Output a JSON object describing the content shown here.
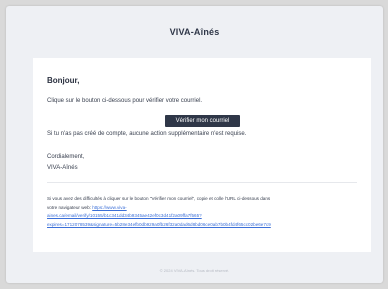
{
  "email": {
    "brand": "VIVA-Aînés",
    "greeting": "Bonjour,",
    "intro": "Clique sur le bouton ci-dessous pour vérifier votre courriel.",
    "verify_button": "Vérifier mon courriel",
    "no_account_note": "Si tu n'as pas créé de compte, aucune action supplémentaire n'est requise.",
    "closing": "Cordialement,",
    "signature": "VIVA-Aînés",
    "fallback_text": "Si vous avez des difficultés à cliquer sur le bouton \"Vérifier mon courriel\", copie et colle l'URL ci-dessous dans",
    "fallback_text_2": "votre navigateur web:",
    "fallback_link_1": "https://www.viva-",
    "fallback_link_2": "aines.ca/email/verify/10155/b1c341dd34b9345ae42ef0c3d41f2a09ffa7f565?",
    "fallback_link_3": "expires=1712078539&signature=5b28e34efb0db929a0fb26f32a0dad6d8bd06ce0ab7b0b4fd4f65cc02be6e7c9",
    "footer": "© 2024 VIVA-Aînés. Tous droit réservé."
  }
}
